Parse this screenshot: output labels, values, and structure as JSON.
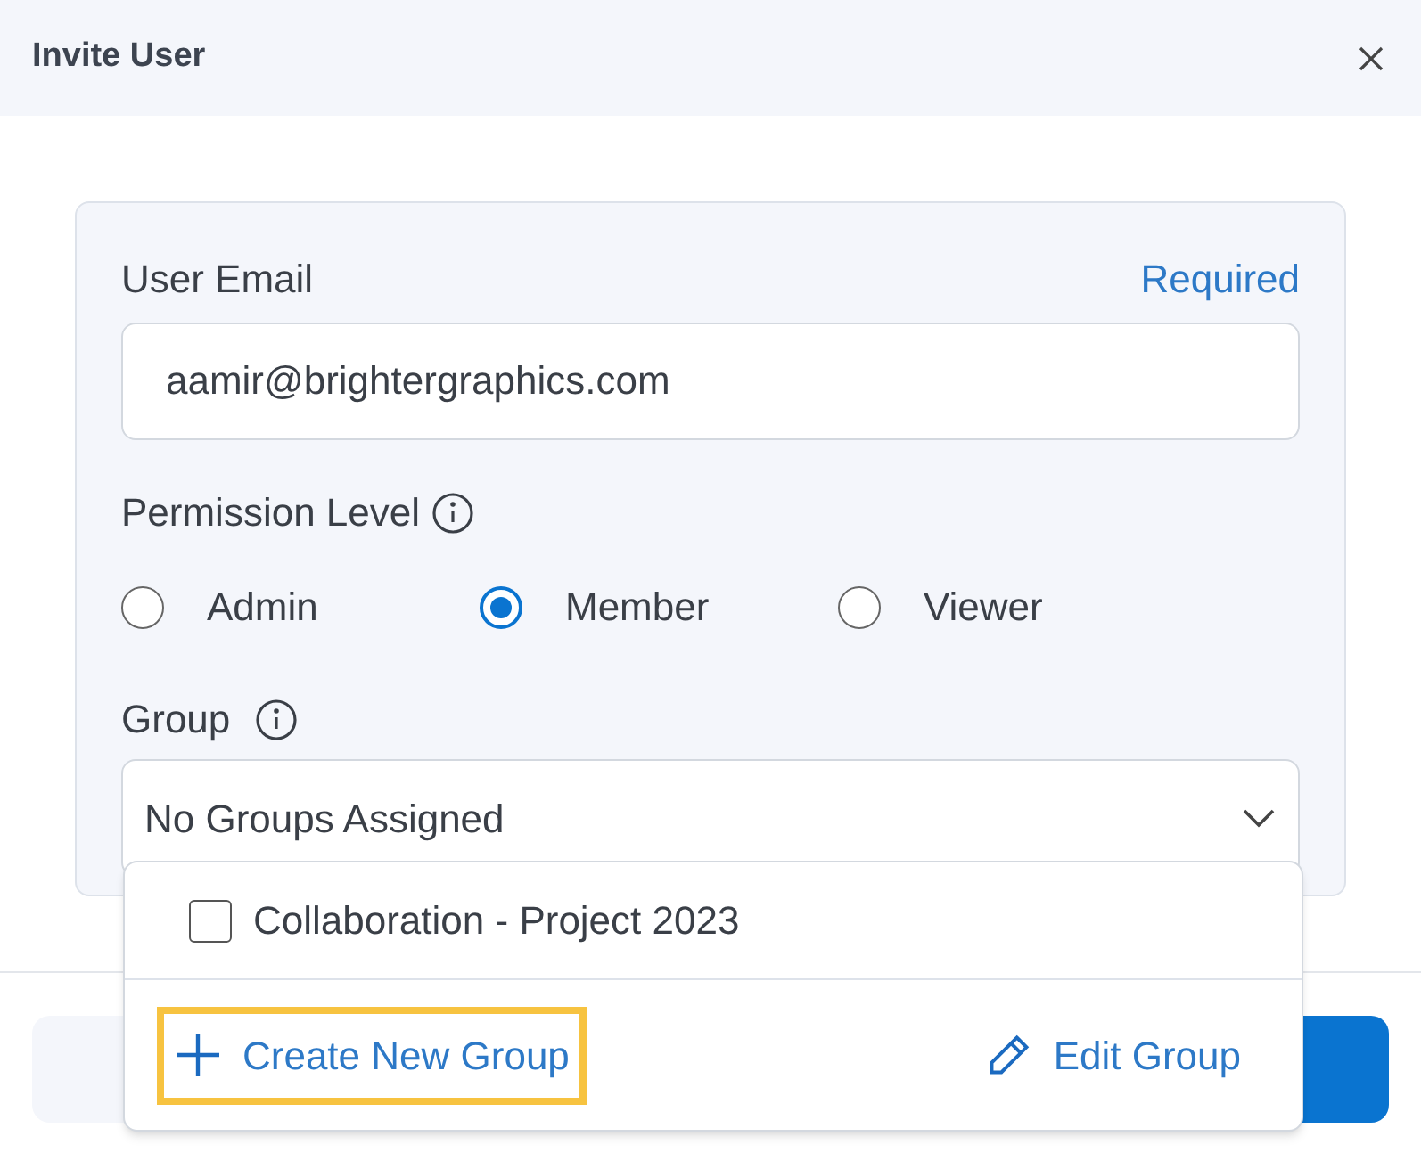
{
  "dialog": {
    "title": "Invite User"
  },
  "email": {
    "label": "User Email",
    "required_text": "Required",
    "value": "aamir@brightergraphics.com"
  },
  "permission": {
    "label": "Permission Level",
    "options": [
      {
        "label": "Admin",
        "selected": false
      },
      {
        "label": "Member",
        "selected": true
      },
      {
        "label": "Viewer",
        "selected": false
      }
    ]
  },
  "group": {
    "label": "Group",
    "value": "No Groups Assigned",
    "expanded": true,
    "items": [
      {
        "label": "Collaboration - Project 2023",
        "checked": false
      }
    ],
    "actions": [
      {
        "kind": "create",
        "label": "Create New Group",
        "highlighted": true
      },
      {
        "kind": "edit",
        "label": "Edit Group",
        "highlighted": false
      }
    ]
  }
}
